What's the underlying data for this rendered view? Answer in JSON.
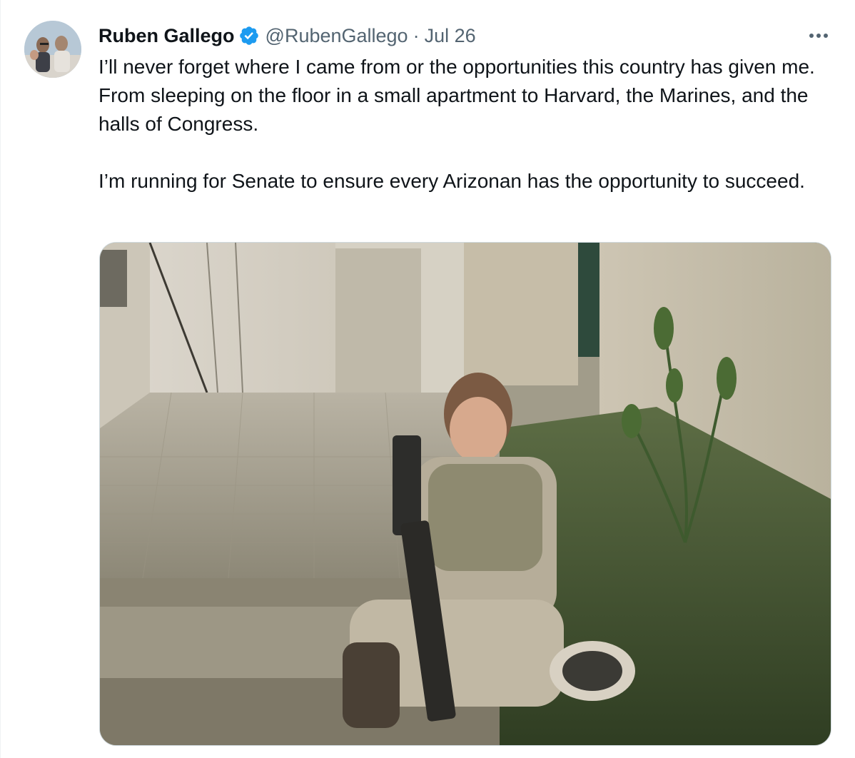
{
  "author": {
    "name": "Ruben Gallego",
    "handle": "@RubenGallego",
    "separator": "·",
    "date": "Jul 26",
    "verified": true,
    "badge_color": "#1d9bf0"
  },
  "tweet": {
    "paragraphs": [
      "I’ll never forget where I came from or the opportunities this country has given me. From sleeping on the floor in a small apartment to Harvard, the Marines, and the halls of Congress.",
      "I’m running for Senate to ensure every Arizonan has the opportunity to succeed."
    ]
  },
  "icons": {
    "more": "more-horizontal-icon",
    "verified": "verified-badge-icon"
  },
  "colors": {
    "text_primary": "#0f1419",
    "text_secondary": "#536471",
    "border": "#cfd9de"
  }
}
